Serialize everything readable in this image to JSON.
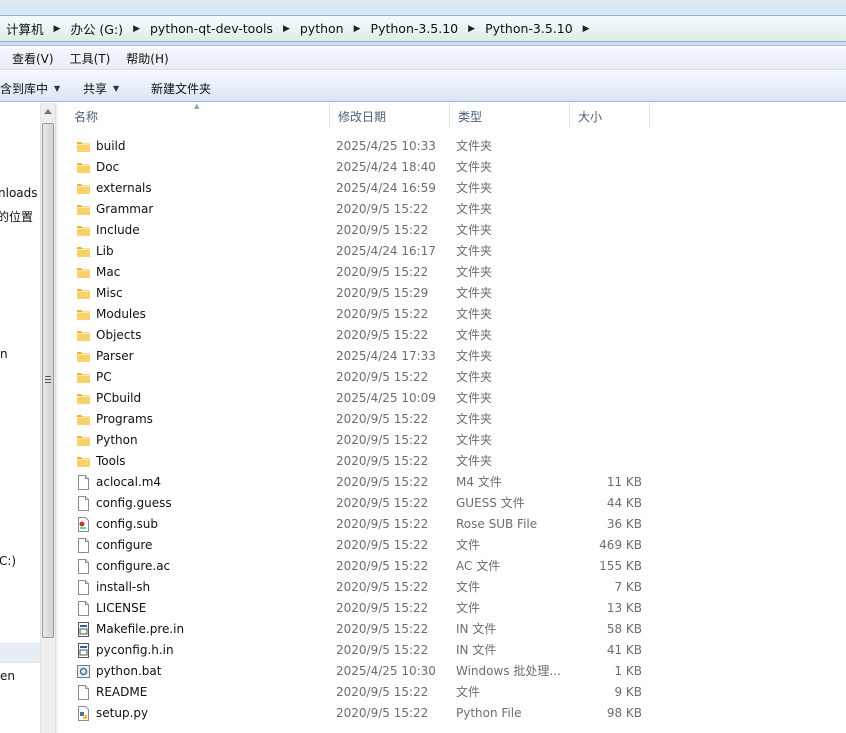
{
  "address": {
    "crumbs": [
      "计算机",
      "办公 (G:)",
      "python-qt-dev-tools",
      "python",
      "Python-3.5.10",
      "Python-3.5.10"
    ]
  },
  "menu": {
    "items": [
      "查看(V)",
      "工具(T)",
      "帮助(H)"
    ]
  },
  "toolbar": {
    "include_library": "包含到库中",
    "share": "共享",
    "new_folder": "新建文件夹"
  },
  "nav": {
    "labels": [
      "nloads",
      "的位置",
      "n",
      "C:)",
      "en"
    ]
  },
  "columns": {
    "name": "名称",
    "date": "修改日期",
    "type": "类型",
    "size": "大小"
  },
  "files": [
    {
      "name": "build",
      "date": "2025/4/25 10:33",
      "type": "文件夹",
      "size": "",
      "icon": "folder-icon"
    },
    {
      "name": "Doc",
      "date": "2025/4/24 18:40",
      "type": "文件夹",
      "size": "",
      "icon": "folder-icon"
    },
    {
      "name": "externals",
      "date": "2025/4/24 16:59",
      "type": "文件夹",
      "size": "",
      "icon": "folder-icon"
    },
    {
      "name": "Grammar",
      "date": "2020/9/5 15:22",
      "type": "文件夹",
      "size": "",
      "icon": "folder-icon"
    },
    {
      "name": "Include",
      "date": "2020/9/5 15:22",
      "type": "文件夹",
      "size": "",
      "icon": "folder-icon"
    },
    {
      "name": "Lib",
      "date": "2025/4/24 16:17",
      "type": "文件夹",
      "size": "",
      "icon": "folder-icon"
    },
    {
      "name": "Mac",
      "date": "2020/9/5 15:22",
      "type": "文件夹",
      "size": "",
      "icon": "folder-icon"
    },
    {
      "name": "Misc",
      "date": "2020/9/5 15:29",
      "type": "文件夹",
      "size": "",
      "icon": "folder-icon"
    },
    {
      "name": "Modules",
      "date": "2020/9/5 15:22",
      "type": "文件夹",
      "size": "",
      "icon": "folder-icon"
    },
    {
      "name": "Objects",
      "date": "2020/9/5 15:22",
      "type": "文件夹",
      "size": "",
      "icon": "folder-icon"
    },
    {
      "name": "Parser",
      "date": "2025/4/24 17:33",
      "type": "文件夹",
      "size": "",
      "icon": "folder-icon"
    },
    {
      "name": "PC",
      "date": "2020/9/5 15:22",
      "type": "文件夹",
      "size": "",
      "icon": "folder-icon"
    },
    {
      "name": "PCbuild",
      "date": "2025/4/25 10:09",
      "type": "文件夹",
      "size": "",
      "icon": "folder-icon"
    },
    {
      "name": "Programs",
      "date": "2020/9/5 15:22",
      "type": "文件夹",
      "size": "",
      "icon": "folder-icon"
    },
    {
      "name": "Python",
      "date": "2020/9/5 15:22",
      "type": "文件夹",
      "size": "",
      "icon": "folder-icon"
    },
    {
      "name": "Tools",
      "date": "2020/9/5 15:22",
      "type": "文件夹",
      "size": "",
      "icon": "folder-icon"
    },
    {
      "name": "aclocal.m4",
      "date": "2020/9/5 15:22",
      "type": "M4 文件",
      "size": "11 KB",
      "icon": "file-icon"
    },
    {
      "name": "config.guess",
      "date": "2020/9/5 15:22",
      "type": "GUESS 文件",
      "size": "44 KB",
      "icon": "file-icon"
    },
    {
      "name": "config.sub",
      "date": "2020/9/5 15:22",
      "type": "Rose SUB File",
      "size": "36 KB",
      "icon": "rose-file-icon"
    },
    {
      "name": "configure",
      "date": "2020/9/5 15:22",
      "type": "文件",
      "size": "469 KB",
      "icon": "file-icon"
    },
    {
      "name": "configure.ac",
      "date": "2020/9/5 15:22",
      "type": "AC 文件",
      "size": "155 KB",
      "icon": "file-icon"
    },
    {
      "name": "install-sh",
      "date": "2020/9/5 15:22",
      "type": "文件",
      "size": "7 KB",
      "icon": "file-icon"
    },
    {
      "name": "LICENSE",
      "date": "2020/9/5 15:22",
      "type": "文件",
      "size": "13 KB",
      "icon": "file-icon"
    },
    {
      "name": "Makefile.pre.in",
      "date": "2020/9/5 15:22",
      "type": "IN 文件",
      "size": "58 KB",
      "icon": "in-file-icon"
    },
    {
      "name": "pyconfig.h.in",
      "date": "2020/9/5 15:22",
      "type": "IN 文件",
      "size": "41 KB",
      "icon": "in-file-icon"
    },
    {
      "name": "python.bat",
      "date": "2025/4/25 10:30",
      "type": "Windows 批处理...",
      "size": "1 KB",
      "icon": "batch-file-icon"
    },
    {
      "name": "README",
      "date": "2020/9/5 15:22",
      "type": "文件",
      "size": "9 KB",
      "icon": "file-icon"
    },
    {
      "name": "setup.py",
      "date": "2020/9/5 15:22",
      "type": "Python File",
      "size": "98 KB",
      "icon": "python-file-icon"
    }
  ],
  "colors": {
    "folder": "#f4c542",
    "accent": "#4c607a"
  }
}
